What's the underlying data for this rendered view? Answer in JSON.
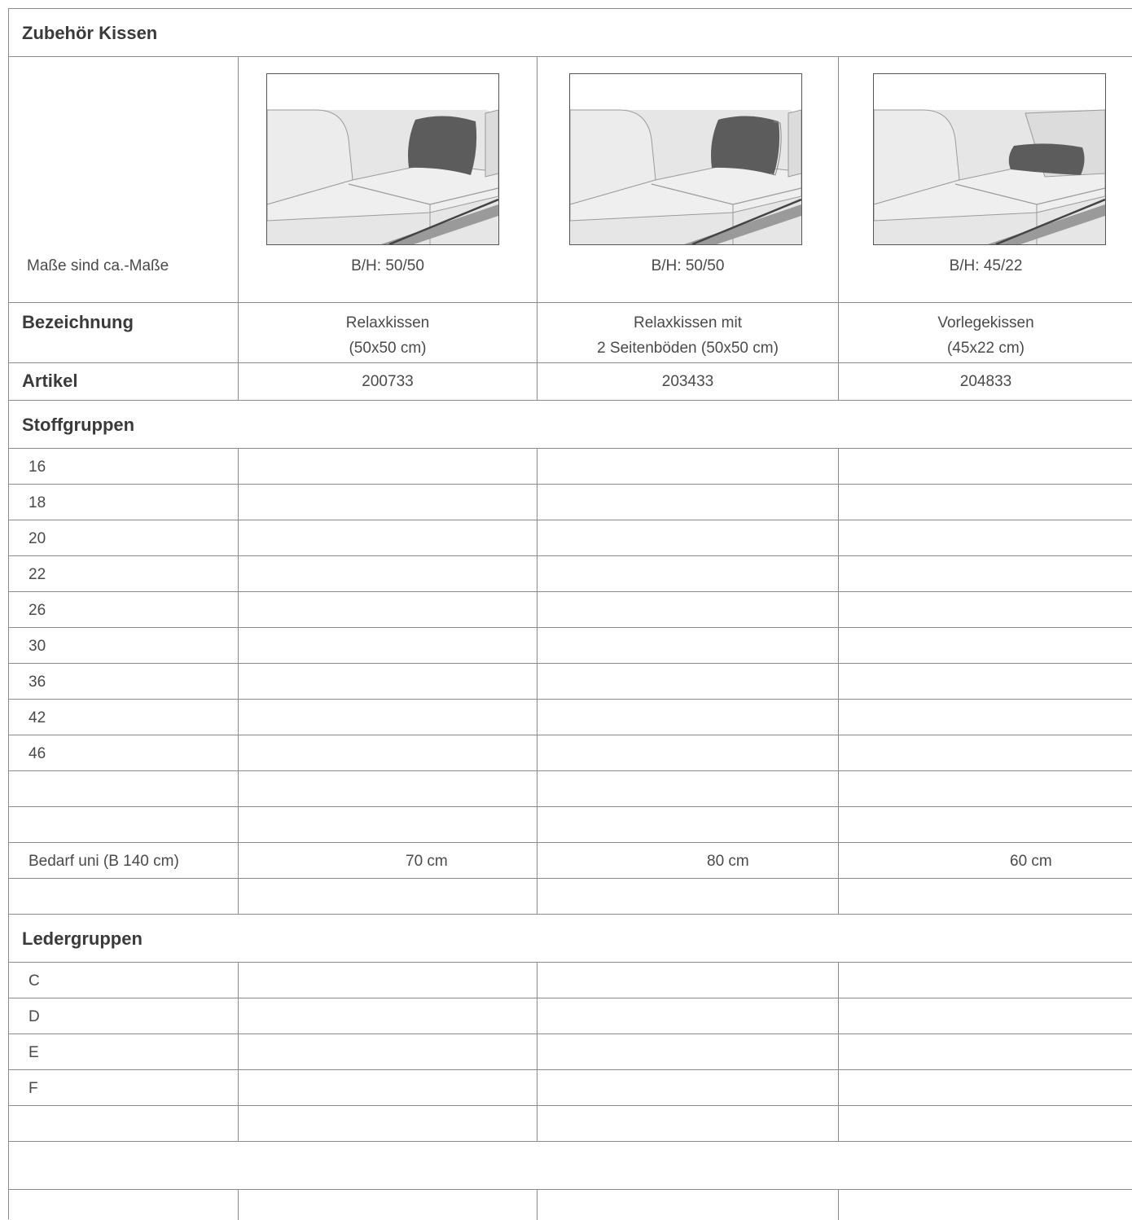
{
  "title": "Zubehör Kissen",
  "measure_note": "Maße sind ca.-Maße",
  "products": [
    {
      "size": "B/H: 50/50",
      "name_line1": "Relaxkissen",
      "name_line2": "(50x50 cm)",
      "article": "200733",
      "bedarf": "70 cm",
      "pillow": "square"
    },
    {
      "size": "B/H: 50/50",
      "name_line1": "Relaxkissen mit",
      "name_line2": "2 Seitenböden (50x50 cm)",
      "article": "203433",
      "bedarf": "80 cm",
      "pillow": "square"
    },
    {
      "size": "B/H: 45/22",
      "name_line1": "Vorlegekissen",
      "name_line2": "(45x22 cm)",
      "article": "204833",
      "bedarf": "60 cm",
      "pillow": "roll"
    }
  ],
  "labels": {
    "bezeichnung": "Bezeichnung",
    "artikel": "Artikel",
    "stoffgruppen": "Stoffgruppen",
    "bedarf": "Bedarf uni (B 140 cm)",
    "ledergruppen": "Ledergruppen"
  },
  "stoff_groups": [
    "16",
    "18",
    "20",
    "22",
    "26",
    "30",
    "36",
    "42",
    "46"
  ],
  "leder_groups": [
    "C",
    "D",
    "E",
    "F"
  ],
  "colors": {
    "grid": "#8a8a8a",
    "pillow": "#5c5c5c",
    "sofa": "#e8e8e8",
    "frame": "#8f8f8f"
  }
}
